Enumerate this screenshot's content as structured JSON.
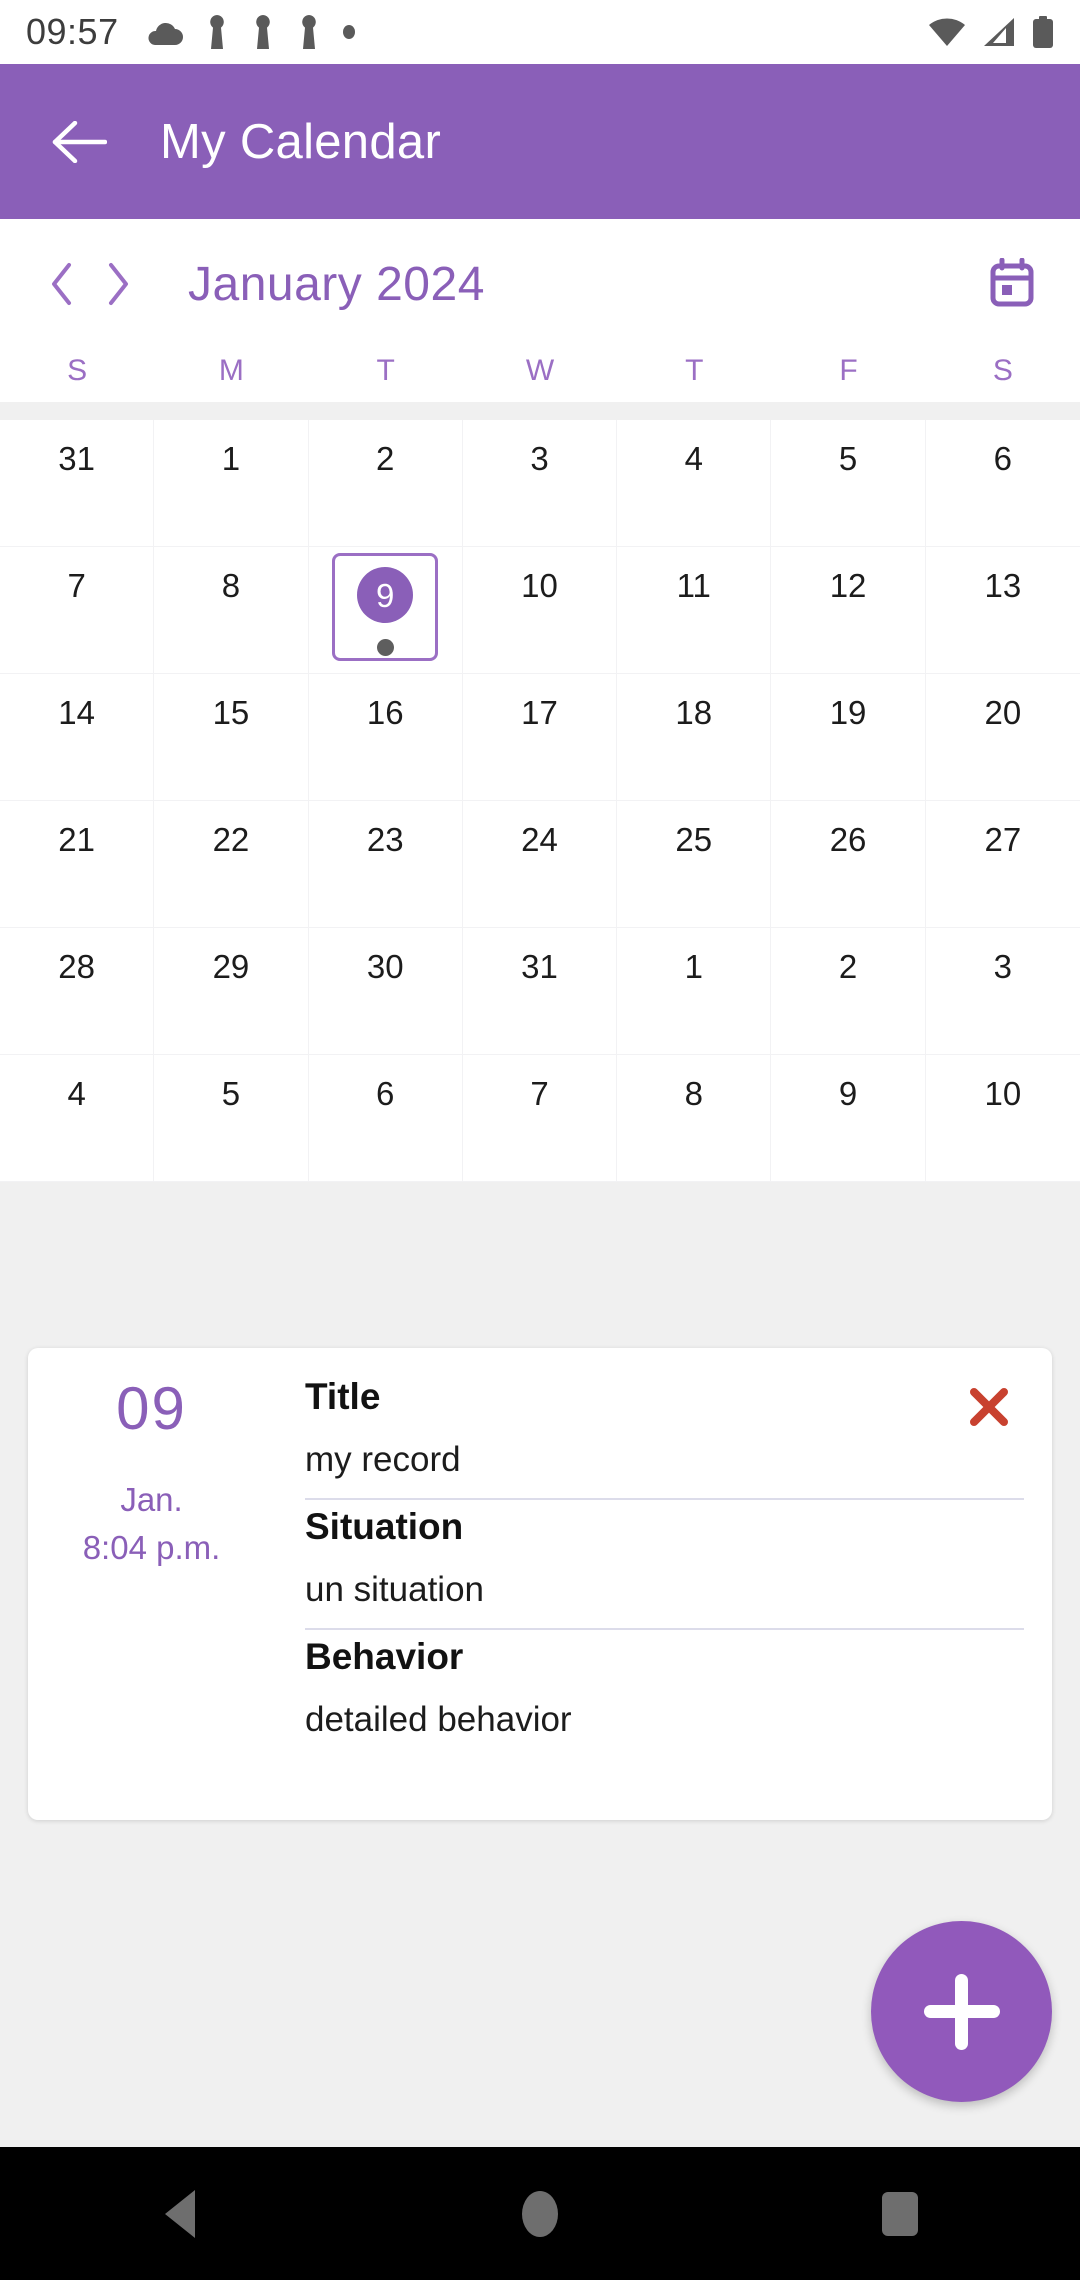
{
  "status_bar": {
    "time": "09:57",
    "left_icons": [
      "cloud-icon",
      "notification-icon",
      "notification-icon",
      "notification-icon",
      "dot-icon"
    ],
    "right_icons": [
      "wifi-icon",
      "signal-icon",
      "battery-icon"
    ]
  },
  "app_bar": {
    "back_icon": "back-arrow-icon",
    "title": "My Calendar"
  },
  "month_header": {
    "prev_icon": "chevron-left-icon",
    "next_icon": "chevron-right-icon",
    "month_label": "January 2024",
    "calendar_icon": "calendar-icon"
  },
  "calendar": {
    "weekday_headers": [
      "S",
      "M",
      "T",
      "W",
      "T",
      "F",
      "S"
    ],
    "weeks": [
      [
        {
          "day": "31",
          "current_month": false,
          "selected": false,
          "has_event": false
        },
        {
          "day": "1",
          "current_month": true,
          "selected": false,
          "has_event": false
        },
        {
          "day": "2",
          "current_month": true,
          "selected": false,
          "has_event": false
        },
        {
          "day": "3",
          "current_month": true,
          "selected": false,
          "has_event": false
        },
        {
          "day": "4",
          "current_month": true,
          "selected": false,
          "has_event": false
        },
        {
          "day": "5",
          "current_month": true,
          "selected": false,
          "has_event": false
        },
        {
          "day": "6",
          "current_month": true,
          "selected": false,
          "has_event": false
        }
      ],
      [
        {
          "day": "7",
          "current_month": true,
          "selected": false,
          "has_event": false
        },
        {
          "day": "8",
          "current_month": true,
          "selected": false,
          "has_event": false
        },
        {
          "day": "9",
          "current_month": true,
          "selected": true,
          "has_event": true
        },
        {
          "day": "10",
          "current_month": true,
          "selected": false,
          "has_event": false
        },
        {
          "day": "11",
          "current_month": true,
          "selected": false,
          "has_event": false
        },
        {
          "day": "12",
          "current_month": true,
          "selected": false,
          "has_event": false
        },
        {
          "day": "13",
          "current_month": true,
          "selected": false,
          "has_event": false
        }
      ],
      [
        {
          "day": "14",
          "current_month": true,
          "selected": false,
          "has_event": false
        },
        {
          "day": "15",
          "current_month": true,
          "selected": false,
          "has_event": false
        },
        {
          "day": "16",
          "current_month": true,
          "selected": false,
          "has_event": false
        },
        {
          "day": "17",
          "current_month": true,
          "selected": false,
          "has_event": false
        },
        {
          "day": "18",
          "current_month": true,
          "selected": false,
          "has_event": false
        },
        {
          "day": "19",
          "current_month": true,
          "selected": false,
          "has_event": false
        },
        {
          "day": "20",
          "current_month": true,
          "selected": false,
          "has_event": false
        }
      ],
      [
        {
          "day": "21",
          "current_month": true,
          "selected": false,
          "has_event": false
        },
        {
          "day": "22",
          "current_month": true,
          "selected": false,
          "has_event": false
        },
        {
          "day": "23",
          "current_month": true,
          "selected": false,
          "has_event": false
        },
        {
          "day": "24",
          "current_month": true,
          "selected": false,
          "has_event": false
        },
        {
          "day": "25",
          "current_month": true,
          "selected": false,
          "has_event": false
        },
        {
          "day": "26",
          "current_month": true,
          "selected": false,
          "has_event": false
        },
        {
          "day": "27",
          "current_month": true,
          "selected": false,
          "has_event": false
        }
      ],
      [
        {
          "day": "28",
          "current_month": true,
          "selected": false,
          "has_event": false
        },
        {
          "day": "29",
          "current_month": true,
          "selected": false,
          "has_event": false
        },
        {
          "day": "30",
          "current_month": true,
          "selected": false,
          "has_event": false
        },
        {
          "day": "31",
          "current_month": true,
          "selected": false,
          "has_event": false
        },
        {
          "day": "1",
          "current_month": false,
          "selected": false,
          "has_event": false
        },
        {
          "day": "2",
          "current_month": false,
          "selected": false,
          "has_event": false
        },
        {
          "day": "3",
          "current_month": false,
          "selected": false,
          "has_event": false
        }
      ],
      [
        {
          "day": "4",
          "current_month": false,
          "selected": false,
          "has_event": false
        },
        {
          "day": "5",
          "current_month": false,
          "selected": false,
          "has_event": false
        },
        {
          "day": "6",
          "current_month": false,
          "selected": false,
          "has_event": false
        },
        {
          "day": "7",
          "current_month": false,
          "selected": false,
          "has_event": false
        },
        {
          "day": "8",
          "current_month": false,
          "selected": false,
          "has_event": false
        },
        {
          "day": "9",
          "current_month": false,
          "selected": false,
          "has_event": false
        },
        {
          "day": "10",
          "current_month": false,
          "selected": false,
          "has_event": false
        }
      ]
    ]
  },
  "record_card": {
    "day": "09",
    "month": "Jan.",
    "time": "8:04 p.m.",
    "close_icon": "close-icon",
    "fields": [
      {
        "label": "Title",
        "value": "my record"
      },
      {
        "label": "Situation",
        "value": "un situation"
      },
      {
        "label": "Behavior",
        "value": "detailed behavior"
      }
    ]
  },
  "fab": {
    "icon": "plus-icon",
    "label": "Add record"
  },
  "nav_bar": {
    "back_icon": "nav-back-icon",
    "home_icon": "nav-home-icon",
    "recents_icon": "nav-recents-icon"
  },
  "colors": {
    "primary": "#8a5fb8",
    "primary_light": "#9b6fc4",
    "fab": "#9159bb",
    "close_red": "#c8412f",
    "page_bg": "#f0f0f0",
    "divider": "#dcdcea"
  }
}
